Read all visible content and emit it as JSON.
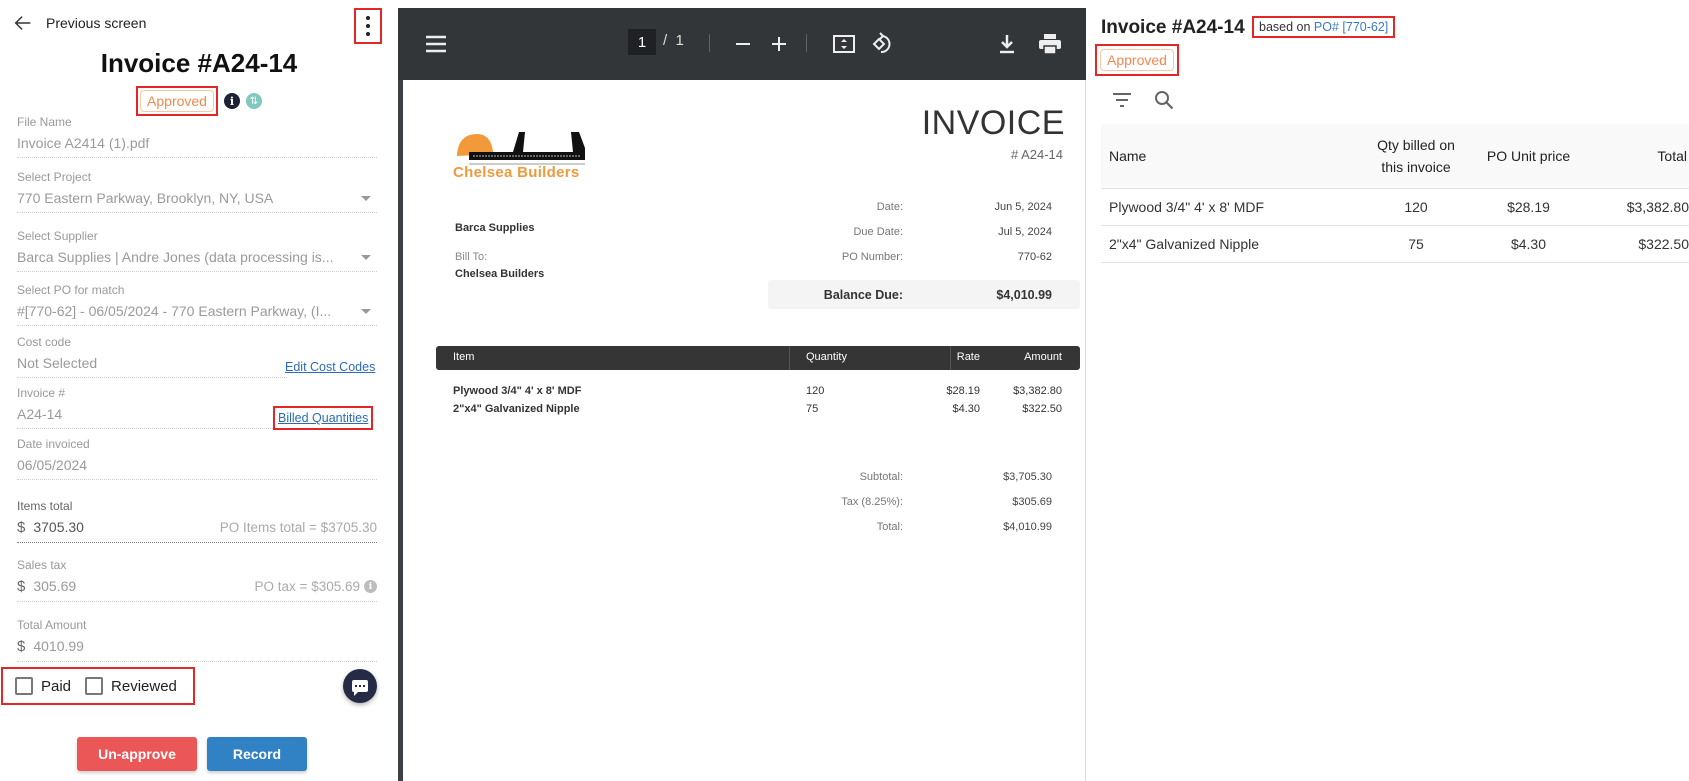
{
  "left": {
    "back_label": "Previous screen",
    "title": "Invoice #A24-14",
    "status": "Approved",
    "fields": {
      "file_name": {
        "label": "File Name",
        "value": "Invoice A2414 (1).pdf"
      },
      "project": {
        "label": "Select Project",
        "value": "770 Eastern Parkway, Brooklyn, NY, USA"
      },
      "supplier": {
        "label": "Select Supplier",
        "value": "Barca Supplies | Andre Jones (data processing is..."
      },
      "po": {
        "label": "Select PO for match",
        "value": "#[770-62] - 06/05/2024 - 770 Eastern Parkway, (I..."
      },
      "cost_code": {
        "label": "Cost code",
        "value": "Not Selected",
        "link": "Edit Cost Codes"
      },
      "invoice_no": {
        "label": "Invoice #",
        "value": "A24-14",
        "link": "Billed Quantities"
      },
      "date": {
        "label": "Date invoiced",
        "value": "06/05/2024"
      },
      "items_total": {
        "label": "Items total",
        "currency": "$",
        "value": "3705.30",
        "hint": "PO Items total = $3705.30"
      },
      "sales_tax": {
        "label": "Sales tax",
        "currency": "$",
        "value": "305.69",
        "hint": "PO tax = $305.69"
      },
      "total": {
        "label": "Total Amount",
        "currency": "$",
        "value": "4010.99"
      }
    },
    "checkboxes": [
      {
        "label": "Paid",
        "checked": false
      },
      {
        "label": "Reviewed",
        "checked": false
      }
    ],
    "buttons": {
      "unapprove": "Un-approve",
      "record": "Record"
    }
  },
  "viewer": {
    "page_current": "1",
    "page_separator": "/",
    "page_total": "1",
    "icons": [
      "menu-icon",
      "zoom-out-icon",
      "zoom-in-icon",
      "fit-page-icon",
      "rotate-icon",
      "download-icon",
      "print-icon"
    ]
  },
  "pdf": {
    "company": "Chelsea Builders",
    "heading": "INVOICE",
    "number": "# A24-14",
    "from": "Barca Supplies",
    "bill_to_label": "Bill To:",
    "bill_to": "Chelsea Builders",
    "meta": [
      {
        "label": "Date:",
        "value": "Jun 5, 2024"
      },
      {
        "label": "Due Date:",
        "value": "Jul 5, 2024"
      },
      {
        "label": "PO Number:",
        "value": "770-62"
      }
    ],
    "balance_label": "Balance Due:",
    "balance_value": "$4,010.99",
    "columns": {
      "item": "Item",
      "quantity": "Quantity",
      "rate": "Rate",
      "amount": "Amount"
    },
    "items": [
      {
        "item": "Plywood 3/4\" 4' x 8' MDF",
        "quantity": "120",
        "rate": "$28.19",
        "amount": "$3,382.80"
      },
      {
        "item": "2\"x4\" Galvanized Nipple",
        "quantity": "75",
        "rate": "$4.30",
        "amount": "$322.50"
      }
    ],
    "totals": [
      {
        "label": "Subtotal:",
        "value": "$3,705.30"
      },
      {
        "label": "Tax (8.25%):",
        "value": "$305.69"
      },
      {
        "label": "Total:",
        "value": "$4,010.99"
      }
    ]
  },
  "right": {
    "title": "Invoice #A24-14",
    "based_on": "based on",
    "po_link": "PO# [770-62]",
    "status": "Approved",
    "columns": {
      "name": "Name",
      "qty_line1": "Qty billed on",
      "qty_line2": "this invoice",
      "price": "PO Unit price",
      "total": "Total"
    },
    "rows": [
      {
        "name": "Plywood 3/4\" 4' x 8' MDF",
        "qty": "120",
        "price": "$28.19",
        "total": "$3,382.80"
      },
      {
        "name": "2\"x4\" Galvanized Nipple",
        "qty": "75",
        "price": "$4.30",
        "total": "$322.50"
      }
    ]
  },
  "colors": {
    "approved": "#f2894f",
    "unapprove": "#eb5757",
    "record": "#3182c4",
    "highlight": "#e32626",
    "link": "#2b6cb8"
  }
}
